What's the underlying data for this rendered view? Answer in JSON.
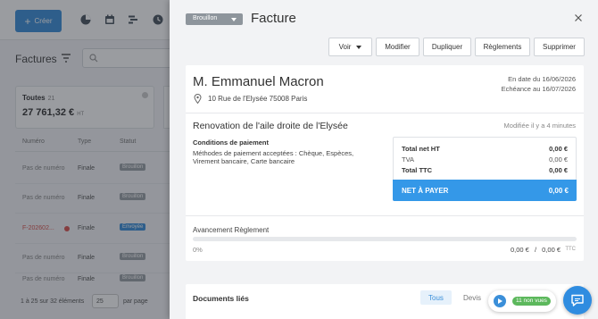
{
  "background": {
    "create_label": "Créer",
    "page_title": "Factures",
    "card": {
      "label": "Toutes",
      "count": "21",
      "amount": "27 761,32 €",
      "unit": "HT"
    },
    "table": {
      "headers": [
        "Numéro",
        "Type",
        "Statut"
      ],
      "rows": [
        {
          "number": "Pas de numéro",
          "type": "Finale",
          "status": "Brouillon",
          "status_color": "#9aa0a6"
        },
        {
          "number": "Pas de numéro",
          "type": "Finale",
          "status": "Brouillon",
          "status_color": "#9aa0a6"
        },
        {
          "number": "F-202602...",
          "type": "Finale",
          "status": "Envoyée",
          "status_color": "#3b8fd9"
        },
        {
          "number": "Pas de numéro",
          "type": "Finale",
          "status": "Brouillon",
          "status_color": "#9aa0a6"
        },
        {
          "number": "Pas de numéro",
          "type": "Finale",
          "status": "Brouillon",
          "status_color": "#9aa0a6"
        }
      ]
    },
    "footer": {
      "range": "1 à 25 sur 32 éléments",
      "per_page_value": "25",
      "per_page_label": "par page"
    }
  },
  "drawer": {
    "status": "Brouillon",
    "title": "Facture",
    "actions": {
      "view": "Voir",
      "edit": "Modifier",
      "duplicate": "Dupliquer",
      "payments": "Règlements",
      "delete": "Supprimer"
    },
    "client": {
      "name": "M. Emmanuel Macron",
      "address": "10 Rue de l'Elysée 75008 Paris"
    },
    "dates": {
      "issued": "En date du 16/06/2026",
      "due": "Echéance au 16/07/2026"
    },
    "project": {
      "title": "Renovation de l'aile droite de l'Elysée",
      "modified": "Modifiée il y a 4 minutes"
    },
    "conditions": {
      "title": "Conditions de paiement",
      "text": "Méthodes de paiement acceptées : Chèque, Espèces, Virement bancaire, Carte bancaire"
    },
    "totals": {
      "total_ht_label": "Total net HT",
      "total_ht": "0,00 €",
      "tva_label": "TVA",
      "tva": "0,00 €",
      "total_ttc_label": "Total TTC",
      "total_ttc": "0,00 €",
      "net_label": "NET À PAYER",
      "net": "0,00 €",
      "net_color": "#3498e8"
    },
    "payment_progress": {
      "title": "Avancement Règlement",
      "percent": "0%",
      "fraction": 0,
      "paid": "0,00 €",
      "separator": "/",
      "total": "0,00 €",
      "unit": "TTC"
    },
    "documents": {
      "title": "Documents liés",
      "tabs": [
        "Tous",
        "Devis"
      ]
    }
  },
  "widgets": {
    "unread_badge": "11 non vues",
    "accent_color": "#2f8ce0"
  }
}
